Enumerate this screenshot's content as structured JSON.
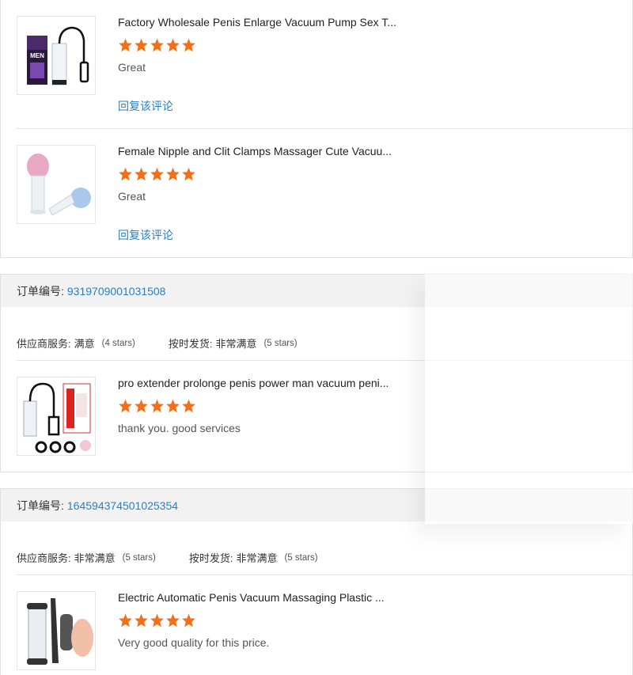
{
  "reviews_top": [
    {
      "product_title": "Factory Wholesale Penis Enlarge Vacuum Pump Sex T...",
      "rating": 5,
      "comment": "Great",
      "reply_label": "回复该评论",
      "thumbnail_icon": "vacuum-pump-men-product-image",
      "thumbnail_box_text": "MEN"
    },
    {
      "product_title": "Female Nipple and Clit Clamps Massager Cute Vacuu...",
      "rating": 5,
      "comment": "Great",
      "reply_label": "回复该评论",
      "thumbnail_icon": "nipple-suction-cups-product-image"
    }
  ],
  "orders": [
    {
      "order_label": "订单编号:",
      "order_number": "9319709001031508",
      "supplier_label": "供应商服务:",
      "supplier_value": "满意",
      "supplier_stars": "(4 stars)",
      "shipping_label": "按时发货:",
      "shipping_value": "非常满意",
      "shipping_stars": "(5 stars)",
      "item": {
        "product_title": "pro extender prolonge penis power man vacuum peni...",
        "rating": 5,
        "comment": "thank you. good services",
        "thumbnail_icon": "vacuum-pump-kit-product-image"
      }
    },
    {
      "order_label": "订单编号:",
      "order_number": "164594374501025354",
      "supplier_label": "供应商服务:",
      "supplier_value": "非常满意",
      "supplier_stars": "(5 stars)",
      "shipping_label": "按时发货:",
      "shipping_value": "非常满意",
      "shipping_stars": "(5 stars)",
      "item": {
        "product_title": "Electric Automatic Penis Vacuum Massaging Plastic ...",
        "rating": 5,
        "comment": "Very good quality for this price.",
        "thumbnail_icon": "electric-pump-product-image"
      }
    }
  ],
  "colors": {
    "star": "#f46d17",
    "link": "#2a7fc1",
    "header_bg": "#f2f2f2"
  }
}
